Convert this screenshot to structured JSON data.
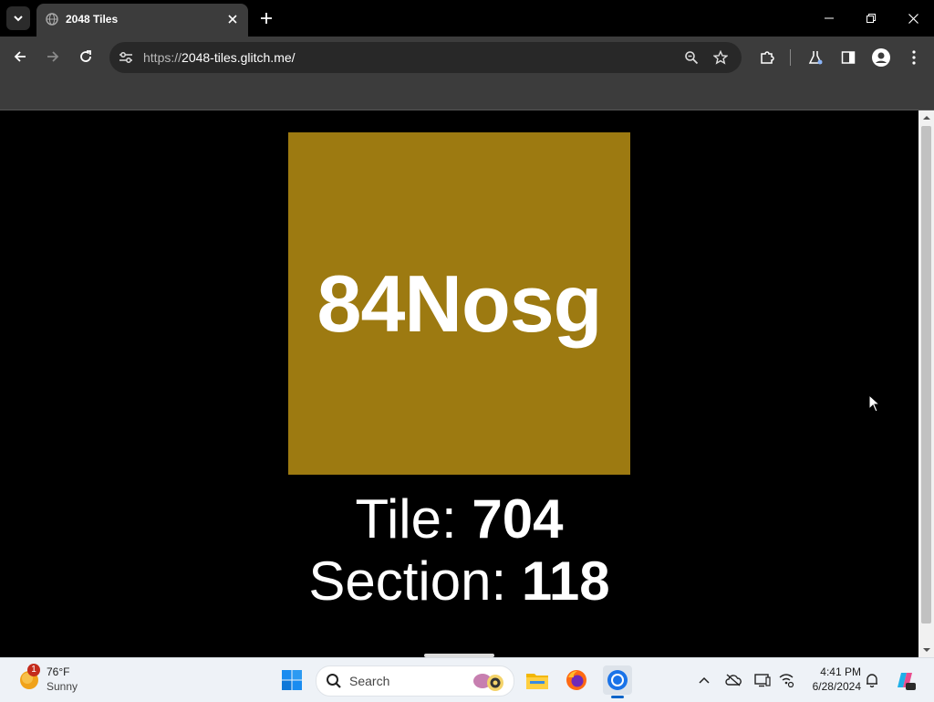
{
  "browser": {
    "tab": {
      "title": "2048 Tiles"
    },
    "url": {
      "scheme": "https://",
      "host": "2048-tiles.glitch.me/"
    }
  },
  "page": {
    "tile": {
      "text": "84Nosg",
      "color": "#9d7a11"
    },
    "tile_info": {
      "label": "Tile:",
      "value": "704"
    },
    "section_info": {
      "label": "Section:",
      "value": "118"
    }
  },
  "taskbar": {
    "weather": {
      "temp": "76°F",
      "condition": "Sunny",
      "badge": "1"
    },
    "search": {
      "label": "Search"
    },
    "clock": {
      "time": "4:41 PM",
      "date": "6/28/2024"
    },
    "apps": [
      "start-icon",
      "file-explorer-icon",
      "firefox-icon",
      "chrome-icon"
    ]
  }
}
